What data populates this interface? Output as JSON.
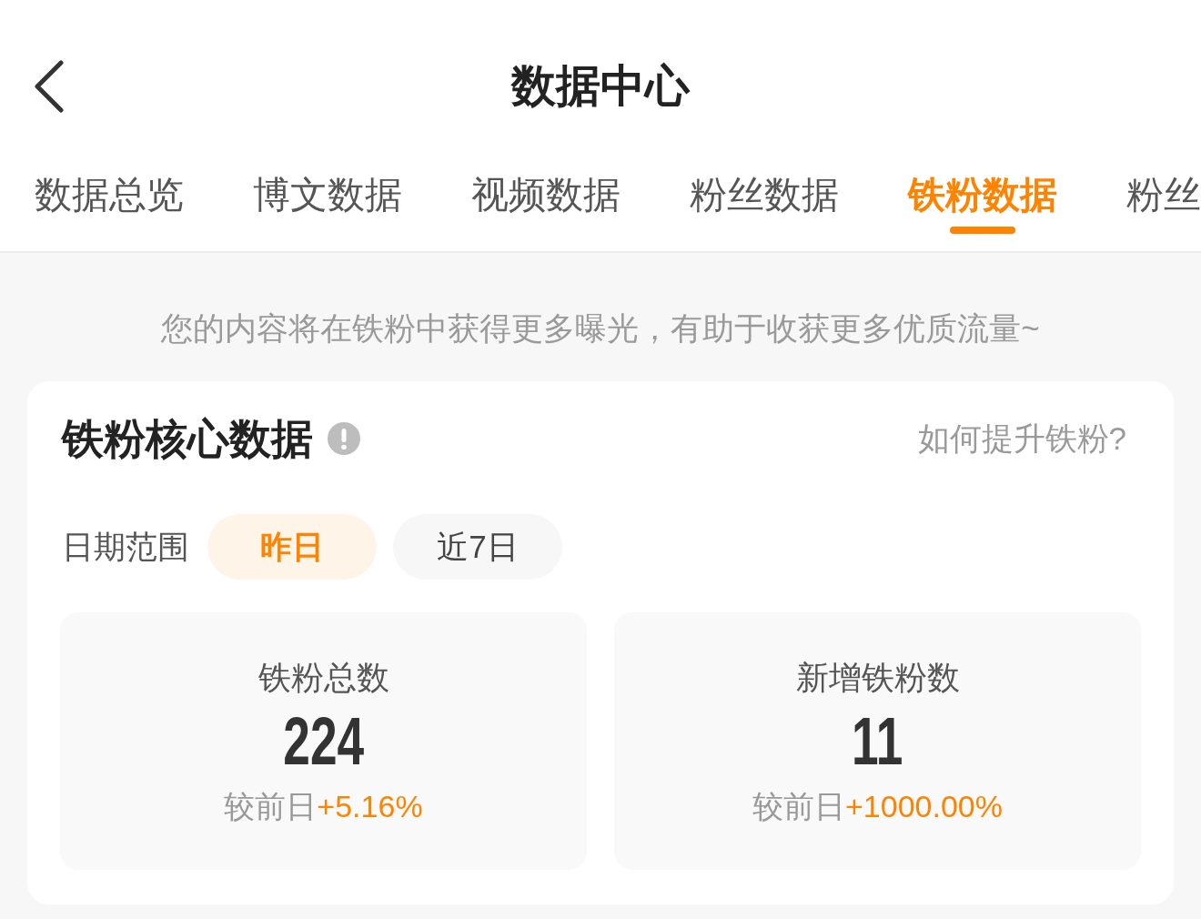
{
  "header": {
    "title": "数据中心"
  },
  "tabs": [
    {
      "label": "数据总览",
      "selected": false
    },
    {
      "label": "博文数据",
      "selected": false
    },
    {
      "label": "视频数据",
      "selected": false
    },
    {
      "label": "粉丝数据",
      "selected": false
    },
    {
      "label": "铁粉数据",
      "selected": true
    },
    {
      "label": "粉丝",
      "selected": false
    }
  ],
  "hint": "您的内容将在铁粉中获得更多曝光，有助于收获更多优质流量~",
  "core_card": {
    "title": "铁粉核心数据",
    "help_link": "如何提升铁粉?",
    "date_range": {
      "label": "日期范围",
      "options": [
        {
          "label": "昨日",
          "selected": true
        },
        {
          "label": "近7日",
          "selected": false
        }
      ]
    },
    "stats": [
      {
        "label": "铁粉总数",
        "value": "224",
        "compare_label": "较前日",
        "change": "+5.16%"
      },
      {
        "label": "新增铁粉数",
        "value": "11",
        "compare_label": "较前日",
        "change": "+1000.00%"
      }
    ]
  }
}
